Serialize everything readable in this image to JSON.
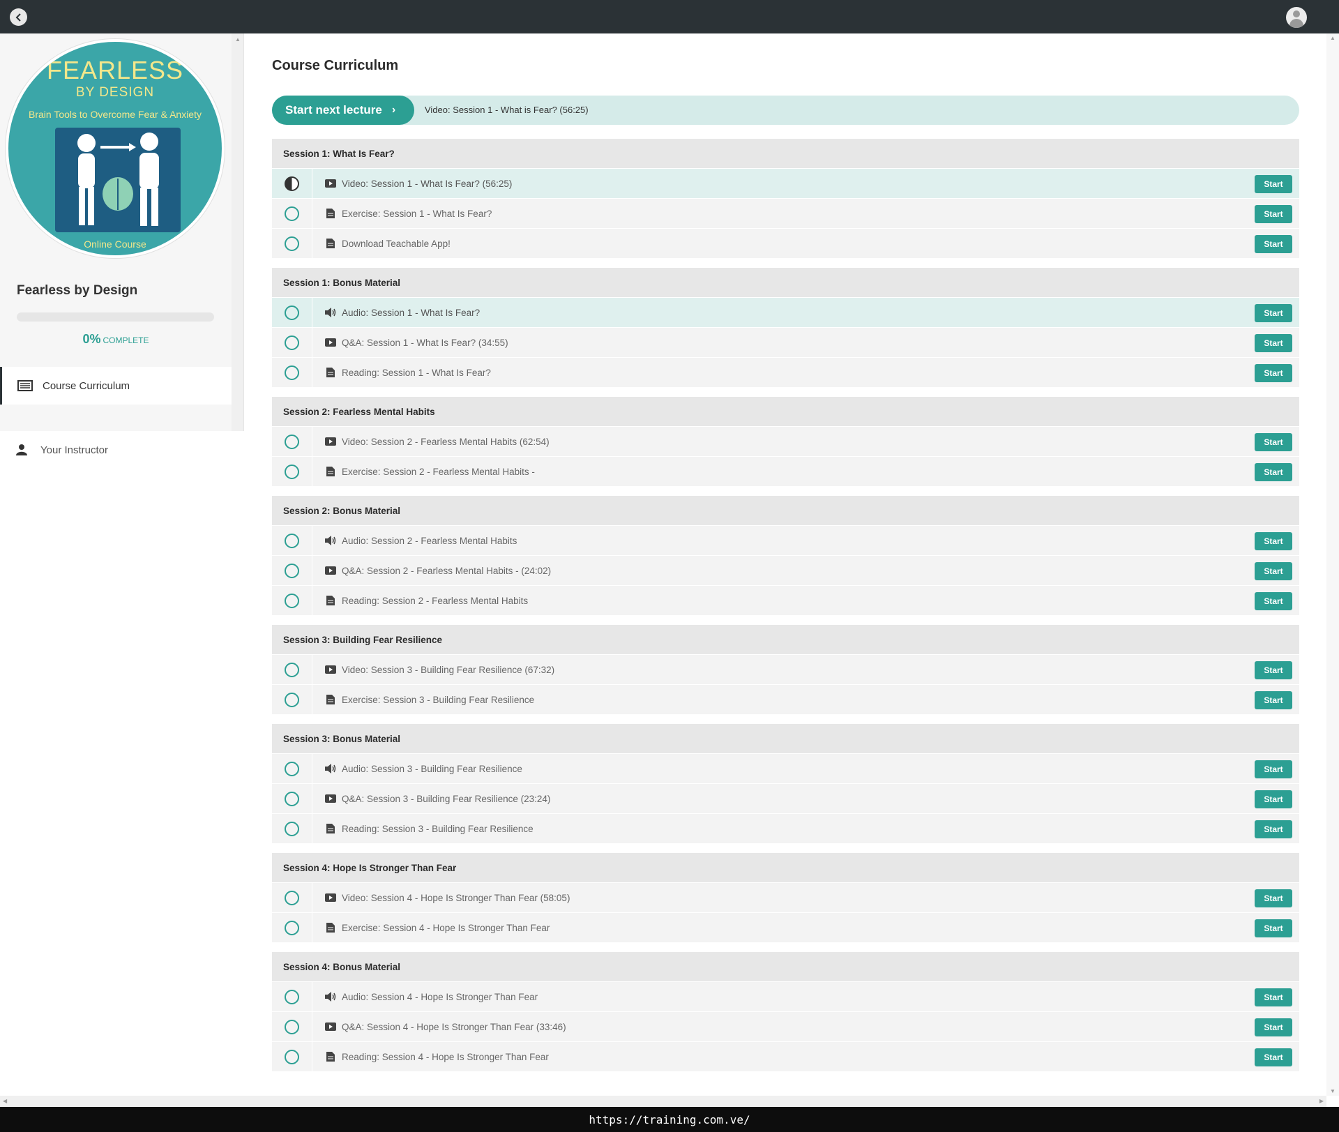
{
  "topbar": {
    "back_icon": "chevron-left-icon",
    "avatar_icon": "user-avatar-icon"
  },
  "sidebar": {
    "logo": {
      "title": "FEARLESS",
      "subtitle": "BY DESIGN",
      "tagline": "Brain Tools to Overcome Fear & Anxiety",
      "footer": "Online Course"
    },
    "course_name": "Fearless by Design",
    "progress": {
      "percent_text": "0%",
      "label": "COMPLETE",
      "value": 0
    },
    "nav": [
      {
        "label": "Course Curriculum",
        "icon": "list-icon",
        "active": true
      },
      {
        "label": "Your Instructor",
        "icon": "person-icon",
        "active": false
      }
    ]
  },
  "main": {
    "title": "Course Curriculum",
    "next": {
      "button_label": "Start next lecture",
      "chevron": "›",
      "lecture": "Video: Session 1 - What is Fear? (56:25)"
    },
    "start_label": "Start",
    "sections": [
      {
        "title": "Session 1: What Is Fear?",
        "lectures": [
          {
            "type": "video",
            "title": "Video: Session 1 - What Is Fear? (56:25)",
            "status": "in-progress",
            "highlight": true
          },
          {
            "type": "doc",
            "title": "Exercise: Session 1 - What Is Fear?",
            "status": "none"
          },
          {
            "type": "doc",
            "title": "Download Teachable App!",
            "status": "none"
          }
        ]
      },
      {
        "title": "Session 1: Bonus Material",
        "lectures": [
          {
            "type": "audio",
            "title": "Audio: Session 1 - What Is Fear?",
            "status": "none",
            "highlight": true
          },
          {
            "type": "video",
            "title": "Q&A: Session 1 - What Is Fear? (34:55)",
            "status": "none"
          },
          {
            "type": "doc",
            "title": "Reading: Session 1 - What Is Fear?",
            "status": "none"
          }
        ]
      },
      {
        "title": "Session 2: Fearless Mental Habits",
        "lectures": [
          {
            "type": "video",
            "title": "Video: Session 2 - Fearless Mental Habits (62:54)",
            "status": "none"
          },
          {
            "type": "doc",
            "title": "Exercise: Session 2 - Fearless Mental Habits -",
            "status": "none"
          }
        ]
      },
      {
        "title": "Session 2: Bonus Material",
        "lectures": [
          {
            "type": "audio",
            "title": "Audio: Session 2 - Fearless Mental Habits",
            "status": "none"
          },
          {
            "type": "video",
            "title": "Q&A: Session 2 - Fearless Mental Habits - (24:02)",
            "status": "none"
          },
          {
            "type": "doc",
            "title": "Reading: Session 2 - Fearless Mental Habits",
            "status": "none"
          }
        ]
      },
      {
        "title": "Session 3: Building Fear Resilience",
        "lectures": [
          {
            "type": "video",
            "title": "Video: Session 3 - Building Fear Resilience (67:32)",
            "status": "none"
          },
          {
            "type": "doc",
            "title": "Exercise: Session 3 - Building Fear Resilience",
            "status": "none"
          }
        ]
      },
      {
        "title": "Session 3: Bonus Material",
        "lectures": [
          {
            "type": "audio",
            "title": "Audio: Session 3 - Building Fear Resilience",
            "status": "none"
          },
          {
            "type": "video",
            "title": "Q&A: Session 3 - Building Fear Resilience (23:24)",
            "status": "none"
          },
          {
            "type": "doc",
            "title": "Reading: Session 3 - Building Fear Resilience",
            "status": "none"
          }
        ]
      },
      {
        "title": "Session 4: Hope Is Stronger Than Fear",
        "lectures": [
          {
            "type": "video",
            "title": "Video: Session 4 - Hope Is Stronger Than Fear (58:05)",
            "status": "none"
          },
          {
            "type": "doc",
            "title": "Exercise: Session 4 - Hope Is Stronger Than Fear",
            "status": "none"
          }
        ]
      },
      {
        "title": "Session 4: Bonus Material",
        "lectures": [
          {
            "type": "audio",
            "title": "Audio: Session 4 - Hope Is Stronger Than Fear",
            "status": "none"
          },
          {
            "type": "video",
            "title": "Q&A: Session 4 - Hope Is Stronger Than Fear (33:46)",
            "status": "none"
          },
          {
            "type": "doc",
            "title": "Reading: Session 4 - Hope Is Stronger Than Fear",
            "status": "none"
          }
        ]
      }
    ]
  },
  "url": "https://training.com.ve/",
  "colors": {
    "accent": "#2c9f93",
    "topbar": "#2b3236",
    "highlight_row": "#dff0ee"
  }
}
